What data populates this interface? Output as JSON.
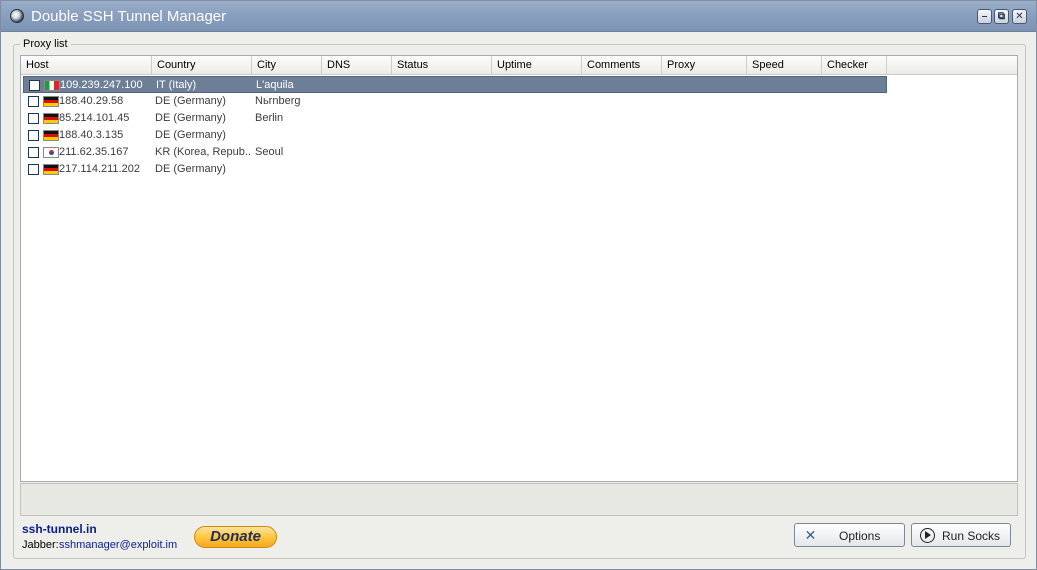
{
  "window": {
    "title": "Double SSH Tunnel Manager",
    "controls": {
      "minimize": "–",
      "maximize": "⧉",
      "close": "✕"
    }
  },
  "proxy_list": {
    "group_label": "Proxy list",
    "columns": [
      "Host",
      "Country",
      "City",
      "DNS",
      "Status",
      "Uptime",
      "Comments",
      "Proxy",
      "Speed",
      "Checker"
    ],
    "rows": [
      {
        "host": "109.239.247.100",
        "country": "IT (Italy)",
        "city": "L'aquila",
        "flag": "it-flag-icon",
        "selected": true,
        "checked": false
      },
      {
        "host": "188.40.29.58",
        "country": "DE (Germany)",
        "city": "Nьrnberg",
        "flag": "de-flag-icon",
        "selected": false,
        "checked": false
      },
      {
        "host": "85.214.101.45",
        "country": "DE (Germany)",
        "city": "Berlin",
        "flag": "de-flag-icon",
        "selected": false,
        "checked": false
      },
      {
        "host": "188.40.3.135",
        "country": "DE (Germany)",
        "city": "",
        "flag": "de-flag-icon",
        "selected": false,
        "checked": false
      },
      {
        "host": "211.62.35.167",
        "country": "KR (Korea, Repub...",
        "city": "Seoul",
        "flag": "kr-flag-icon",
        "selected": false,
        "checked": false
      },
      {
        "host": "217.114.211.202",
        "country": "DE (Germany)",
        "city": "",
        "flag": "de-flag-icon",
        "selected": false,
        "checked": false
      }
    ]
  },
  "footer": {
    "site_link": "ssh-tunnel.in",
    "jabber_label": "Jabber:",
    "jabber_address": "sshmanager@exploit.im",
    "donate_label": "Donate",
    "options_label": "Options",
    "options_icon": "tools-icon",
    "run_socks_label": "Run Socks",
    "run_socks_icon": "play-icon"
  },
  "colors": {
    "titlebar": "#8aa0bf",
    "selection": "#6d7e97",
    "link": "#0a1d8f",
    "donate": "#ffc43a"
  }
}
